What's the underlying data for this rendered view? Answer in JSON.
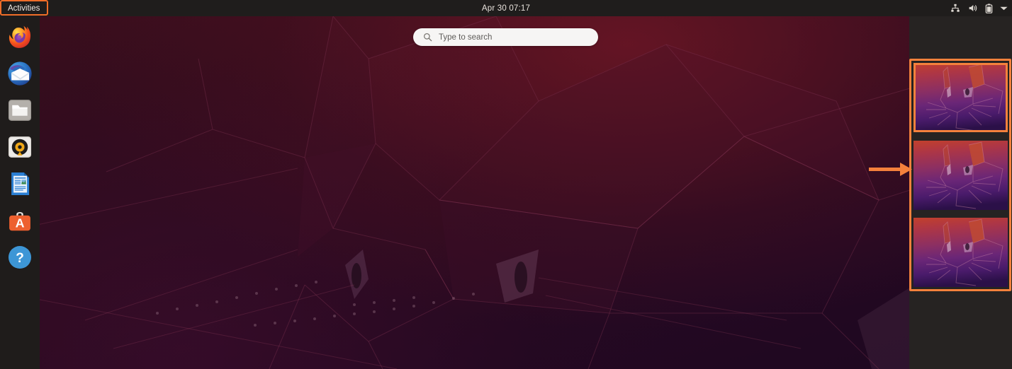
{
  "topbar": {
    "activities_label": "Activities",
    "clock": "Apr 30  07:17",
    "tray_icons": [
      {
        "name": "network-wired-icon",
        "label": "Network"
      },
      {
        "name": "volume-icon",
        "label": "Volume"
      },
      {
        "name": "battery-icon",
        "label": "Battery"
      },
      {
        "name": "chevron-down-icon",
        "label": "System menu"
      }
    ]
  },
  "search": {
    "placeholder": "Type to search",
    "value": "",
    "icon": "search-icon"
  },
  "dock": {
    "items": [
      {
        "name": "dock-item-firefox",
        "label": "Firefox",
        "icon": "firefox-icon"
      },
      {
        "name": "dock-item-thunderbird",
        "label": "Thunderbird Mail",
        "icon": "thunderbird-icon"
      },
      {
        "name": "dock-item-files",
        "label": "Files",
        "icon": "folder-icon"
      },
      {
        "name": "dock-item-rhythmbox",
        "label": "Rhythmbox",
        "icon": "music-icon"
      },
      {
        "name": "dock-item-libreoffice-writer",
        "label": "LibreOffice Writer",
        "icon": "document-icon"
      },
      {
        "name": "dock-item-ubuntu-software",
        "label": "Ubuntu Software",
        "icon": "software-bag-icon"
      },
      {
        "name": "dock-item-help",
        "label": "Help",
        "icon": "help-icon"
      }
    ]
  },
  "workspaces": {
    "count": 3,
    "selected_index": 0,
    "thumbnails": [
      {
        "name": "workspace-thumbnail-1",
        "label": "Workspace 1"
      },
      {
        "name": "workspace-thumbnail-2",
        "label": "Workspace 2"
      },
      {
        "name": "workspace-thumbnail-3",
        "label": "Workspace 3"
      }
    ]
  },
  "annotations": {
    "accent_color": "#f4813c",
    "highlight_color": "#f06d28",
    "activities_box": "Activities button highlighted",
    "workspace_box": "Workspace switcher highlighted",
    "arrow": "arrow pointing at workspace switcher"
  },
  "colors": {
    "topbar_bg": "#1f1d1c",
    "dock_bg": "#1f1c1b",
    "workspace_panel_bg": "#262322",
    "search_bg": "#f6f5f4",
    "wallpaper_base": "#2c0b1e"
  }
}
